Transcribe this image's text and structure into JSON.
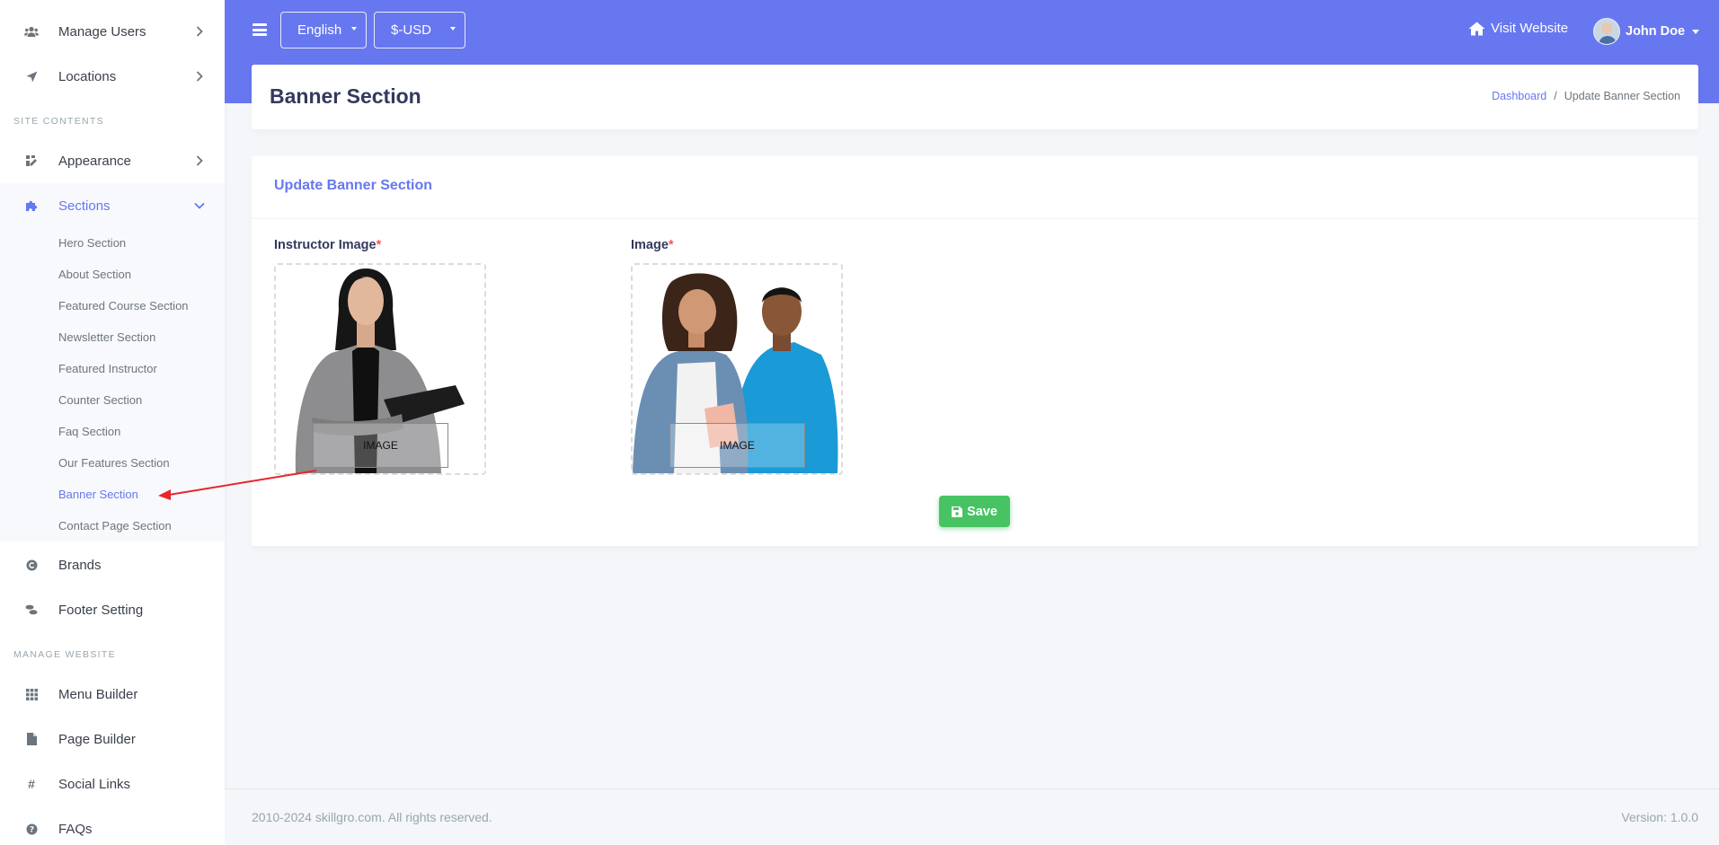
{
  "sidebar": {
    "manage_users": "Manage Users",
    "locations": "Locations",
    "site_contents": "SITE CONTENTS",
    "appearance": "Appearance",
    "sections": "Sections",
    "sub_items": [
      "Hero Section",
      "About Section",
      "Featured Course Section",
      "Newsletter Section",
      "Featured Instructor",
      "Counter Section",
      "Faq Section",
      "Our Features Section",
      "Banner Section",
      "Contact Page Section"
    ],
    "brands": "Brands",
    "footer_setting": "Footer Setting",
    "manage_website": "MANAGE WEBSITE",
    "menu_builder": "Menu Builder",
    "page_builder": "Page Builder",
    "social_links": "Social Links",
    "faqs": "FAQs"
  },
  "topbar": {
    "language": "English",
    "currency": "$-USD",
    "visit_website": "Visit Website",
    "user_name": "John Doe"
  },
  "header": {
    "title": "Banner Section",
    "breadcrumb_link": "Dashboard",
    "breadcrumb_sep": "/",
    "breadcrumb_current": "Update Banner Section"
  },
  "form": {
    "card_title": "Update Banner Section",
    "instructor_label": "Instructor Image",
    "image_label": "Image",
    "required_mark": "*",
    "image_placeholder": "IMAGE",
    "save_label": "Save"
  },
  "footer": {
    "copyright": "2010-2024 skillgro.com. All rights reserved.",
    "version": "Version: 1.0.0"
  },
  "colors": {
    "primary": "#6777ef",
    "success": "#47c363",
    "danger": "#fc544b",
    "annotation_arrow": "#e8262b"
  }
}
